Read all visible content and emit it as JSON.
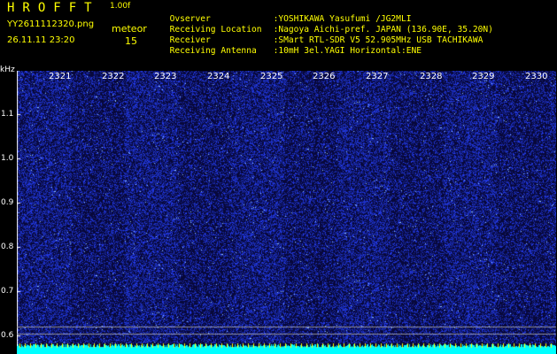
{
  "header": {
    "app_title": "HROFFT",
    "version": "1.00f",
    "filename": "YY2611112320.png",
    "timestamp": "26.11.11 23:20",
    "meteor_label": "meteor",
    "meteor_count": "15"
  },
  "info": [
    {
      "key": "Ovserver",
      "value": ":YOSHIKAWA Yasufumi /JG2MLI"
    },
    {
      "key": "Receiving Location",
      "value": ":Nagoya Aichi-pref. JAPAN (136.90E, 35.20N)"
    },
    {
      "key": "Receiver",
      "value": ":SMart RTL-SDR V5 52.905MHz USB TACHIKAWA"
    },
    {
      "key": "Receiving Antenna",
      "value": ":10mH 3el.YAGI Horizontal:ENE"
    }
  ],
  "plot": {
    "y_unit": "kHz",
    "y_ticks": [
      "1.1",
      "1.0",
      "0.9",
      "0.8",
      "0.7",
      "0.6"
    ],
    "x_ticks": [
      "2321",
      "2322",
      "2323",
      "2324",
      "2325",
      "2326",
      "2327",
      "2328",
      "2329",
      "2330"
    ],
    "colors": {
      "background": "#0a0a40",
      "noise": "#3050ff",
      "baseline": "#00ffff",
      "axis": "#ffffff",
      "text": "#ffff00"
    }
  }
}
